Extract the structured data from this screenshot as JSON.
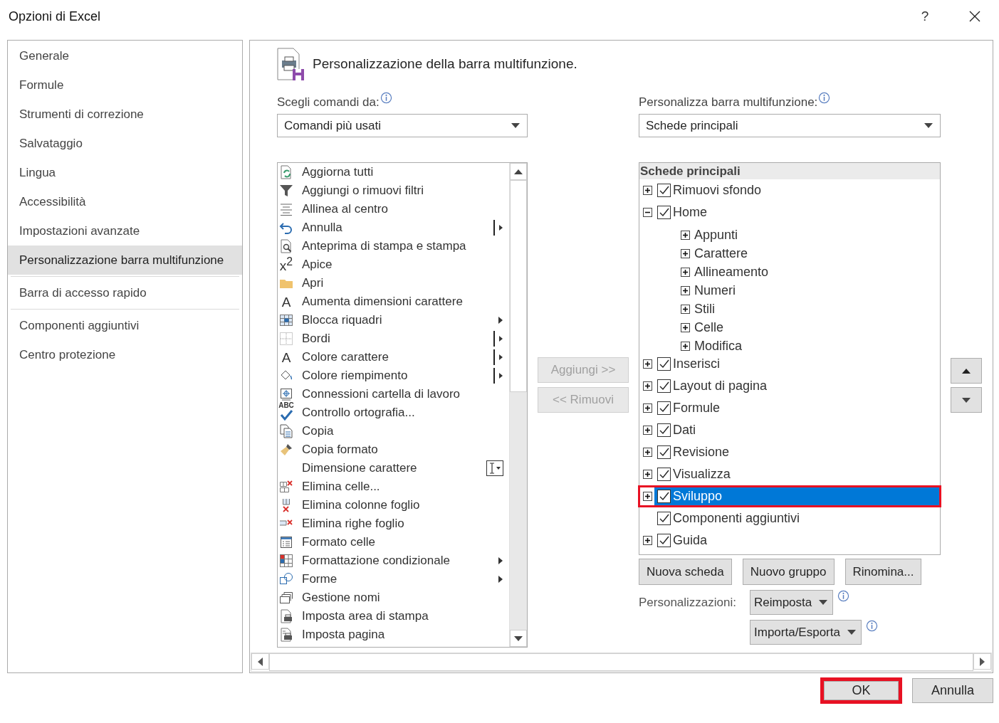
{
  "window": {
    "title": "Opzioni di Excel",
    "help": "?"
  },
  "nav": {
    "sections": [
      {
        "items": [
          {
            "label": "Generale",
            "selected": false
          },
          {
            "label": "Formule",
            "selected": false
          },
          {
            "label": "Strumenti di correzione",
            "selected": false
          },
          {
            "label": "Salvataggio",
            "selected": false
          },
          {
            "label": "Lingua",
            "selected": false
          },
          {
            "label": "Accessibilità",
            "selected": false
          },
          {
            "label": "Impostazioni avanzate",
            "selected": false
          },
          {
            "label": "Personalizzazione barra multifunzione",
            "selected": true
          }
        ]
      },
      {
        "items": [
          {
            "label": "Barra di accesso rapido",
            "selected": false
          }
        ]
      },
      {
        "items": [
          {
            "label": "Componenti aggiuntivi",
            "selected": false
          },
          {
            "label": "Centro protezione",
            "selected": false
          }
        ]
      }
    ]
  },
  "page": {
    "title": "Personalizzazione della barra multifunzione.",
    "commands_source": {
      "label": "Scegli comandi da:",
      "value": "Comandi più usati"
    },
    "commands": [
      {
        "label": "Aggiorna tutti",
        "kind": "plain"
      },
      {
        "label": "Aggiungi o rimuovi filtri",
        "kind": "plain"
      },
      {
        "label": "Allinea al centro",
        "kind": "plain"
      },
      {
        "label": "Annulla",
        "kind": "split"
      },
      {
        "label": "Anteprima di stampa e stampa",
        "kind": "plain"
      },
      {
        "label": "Apice",
        "kind": "plain",
        "glyph": "x$^{2}$"
      },
      {
        "label": "Apri",
        "kind": "plain"
      },
      {
        "label": "Aumenta dimensioni carattere",
        "kind": "plain",
        "glyph": "A"
      },
      {
        "label": "Blocca riquadri",
        "kind": "submenu"
      },
      {
        "label": "Bordi",
        "kind": "split"
      },
      {
        "label": "Colore carattere",
        "kind": "split",
        "glyph": "A"
      },
      {
        "label": "Colore riempimento",
        "kind": "split"
      },
      {
        "label": "Connessioni cartella di lavoro",
        "kind": "plain"
      },
      {
        "label": "Controllo ortografia...",
        "kind": "plain",
        "glyph": "ABC"
      },
      {
        "label": "Copia",
        "kind": "plain"
      },
      {
        "label": "Copia formato",
        "kind": "plain"
      },
      {
        "label": "Dimensione carattere",
        "kind": "field"
      },
      {
        "label": "Elimina celle...",
        "kind": "plain"
      },
      {
        "label": "Elimina colonne foglio",
        "kind": "plain"
      },
      {
        "label": "Elimina righe foglio",
        "kind": "plain"
      },
      {
        "label": "Formato celle",
        "kind": "plain"
      },
      {
        "label": "Formattazione condizionale",
        "kind": "submenu"
      },
      {
        "label": "Forme",
        "kind": "submenu"
      },
      {
        "label": "Gestione nomi",
        "kind": "plain"
      },
      {
        "label": "Imposta area di stampa",
        "kind": "plain"
      },
      {
        "label": "Imposta pagina",
        "kind": "plain"
      }
    ],
    "add_button": {
      "label": "Aggiungi >>",
      "disabled": true
    },
    "remove_button": {
      "label": "<< Rimuovi",
      "disabled": true
    },
    "ribbon_target": {
      "label": "Personalizza barra multifunzione:",
      "value": "Schede principali"
    },
    "ribbon_tree": {
      "header": "Schede principali",
      "items": [
        {
          "label": "Rimuovi sfondo",
          "kind": "tab",
          "expanded": false,
          "checked": true,
          "selected": false,
          "highlighted": false
        },
        {
          "label": "Home",
          "kind": "tab",
          "expanded": true,
          "checked": true,
          "selected": false,
          "highlighted": false,
          "children": [
            {
              "label": "Appunti",
              "expanded": false
            },
            {
              "label": "Carattere",
              "expanded": false
            },
            {
              "label": "Allineamento",
              "expanded": false
            },
            {
              "label": "Numeri",
              "expanded": false
            },
            {
              "label": "Stili",
              "expanded": false
            },
            {
              "label": "Celle",
              "expanded": false
            },
            {
              "label": "Modifica",
              "expanded": false
            }
          ]
        },
        {
          "label": "Inserisci",
          "kind": "tab",
          "expanded": false,
          "checked": true,
          "selected": false,
          "highlighted": false
        },
        {
          "label": "Layout di pagina",
          "kind": "tab",
          "expanded": false,
          "checked": true,
          "selected": false,
          "highlighted": false
        },
        {
          "label": "Formule",
          "kind": "tab",
          "expanded": false,
          "checked": true,
          "selected": false,
          "highlighted": false
        },
        {
          "label": "Dati",
          "kind": "tab",
          "expanded": false,
          "checked": true,
          "selected": false,
          "highlighted": false
        },
        {
          "label": "Revisione",
          "kind": "tab",
          "expanded": false,
          "checked": true,
          "selected": false,
          "highlighted": false
        },
        {
          "label": "Visualizza",
          "kind": "tab",
          "expanded": false,
          "checked": true,
          "selected": false,
          "highlighted": false
        },
        {
          "label": "Sviluppo",
          "kind": "tab",
          "expanded": false,
          "checked": true,
          "selected": true,
          "highlighted": true
        },
        {
          "label": "Componenti aggiuntivi",
          "kind": "leaf",
          "checked": true,
          "selected": false,
          "highlighted": false
        },
        {
          "label": "Guida",
          "kind": "tab",
          "expanded": false,
          "checked": true,
          "selected": false,
          "highlighted": false
        }
      ]
    },
    "tree_buttons": [
      "Nuova scheda",
      "Nuovo gruppo",
      "Rinomina..."
    ],
    "customizations": {
      "label": "Personalizzazioni:",
      "reset": "Reimposta",
      "import_export": "Importa/Esporta"
    }
  },
  "footer": {
    "buttons": [
      {
        "label": "OK",
        "highlighted": true
      },
      {
        "label": "Annulla",
        "highlighted": false
      }
    ]
  }
}
